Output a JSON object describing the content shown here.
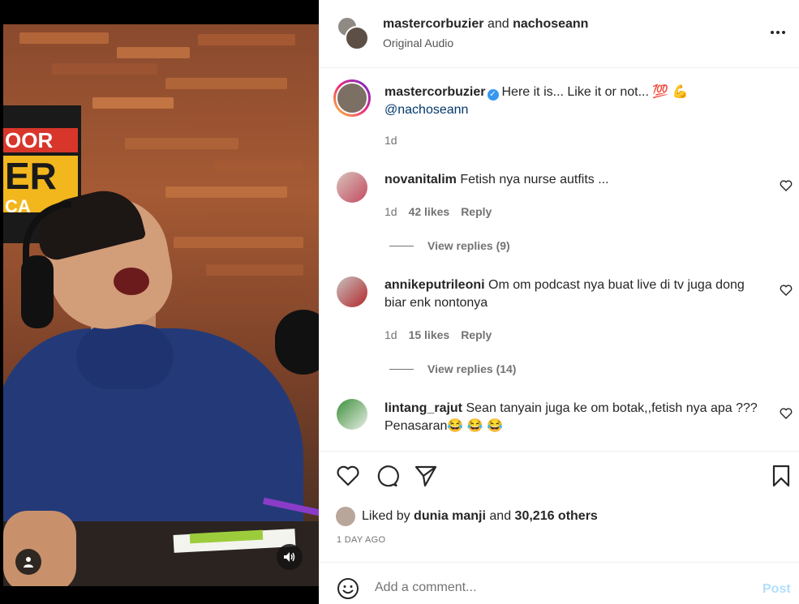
{
  "header": {
    "user1": "mastercorbuzier",
    "joiner": " and ",
    "user2": "nachoseann",
    "audio": "Original Audio"
  },
  "caption": {
    "username": "mastercorbuzier",
    "text": "Here it is... Like it or not... 💯 💪",
    "mention": "@nachoseann",
    "time": "1d"
  },
  "comments": [
    {
      "username": "novanitalim",
      "text": "Fetish nya nurse autfits ...",
      "time": "1d",
      "likes": "42 likes",
      "reply": "Reply",
      "view_replies": "View replies (9)"
    },
    {
      "username": "annikeputrileoni",
      "text": "Om om podcast nya buat live di tv juga dong biar enk nontonya",
      "time": "1d",
      "likes": "15 likes",
      "reply": "Reply",
      "view_replies": "View replies (14)"
    },
    {
      "username": "lintang_rajut",
      "text": "Sean tanyain juga ke om botak,,fetish nya apa ??? Penasaran😂 😂 😂"
    }
  ],
  "likes": {
    "prefix": "Liked by ",
    "user": "dunia manji",
    "mid": " and ",
    "others": "30,216 others"
  },
  "time_ago": "1 DAY AGO",
  "add_comment": {
    "placeholder": "Add a comment...",
    "post": "Post"
  },
  "video_sign": {
    "line1": "OOR",
    "line2": "ER",
    "line3": "CA"
  },
  "colors": {
    "verified": "#3897f0",
    "post": "#b2dffc",
    "mention": "#00376b"
  },
  "icons": [
    "more-options-icon",
    "heart-icon",
    "comment-icon",
    "share-icon",
    "bookmark-icon",
    "emoji-icon",
    "user-tag-icon",
    "sound-icon",
    "verified-badge-icon"
  ]
}
